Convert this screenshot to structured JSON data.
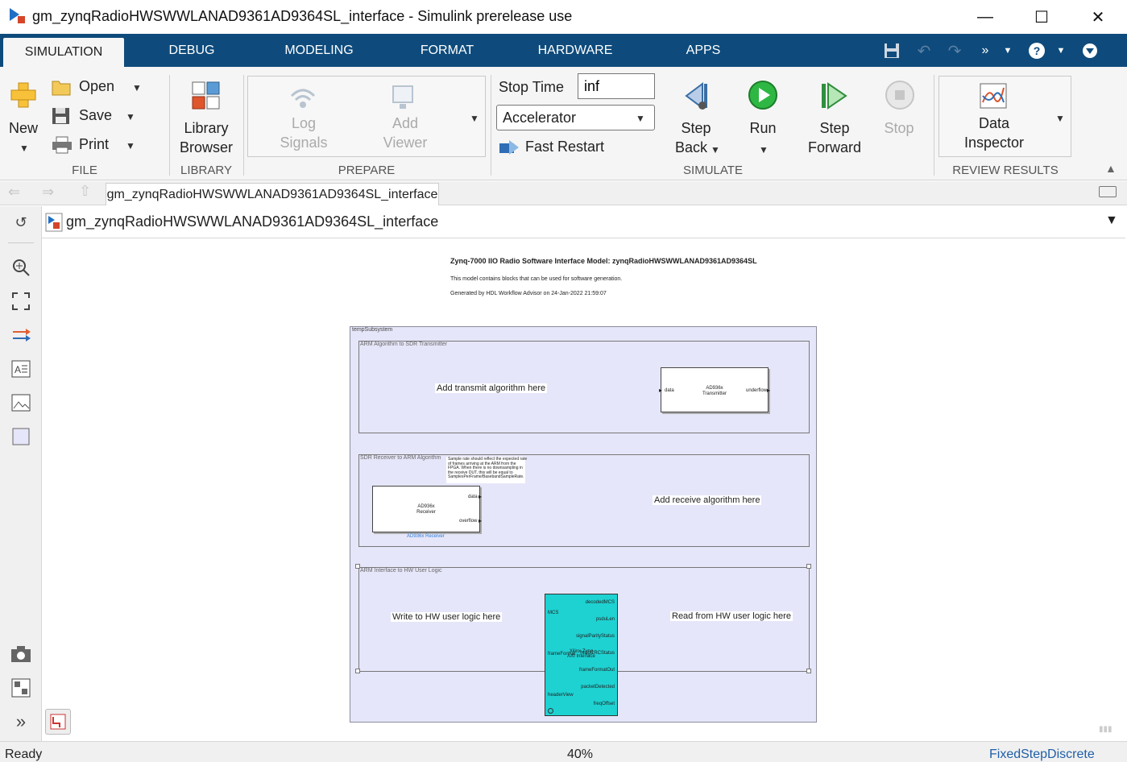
{
  "window": {
    "title": "gm_zynqRadioHWSWWLANAD9361AD9364SL_interface - Simulink prerelease use"
  },
  "ribbon_tabs": [
    "SIMULATION",
    "DEBUG",
    "MODELING",
    "FORMAT",
    "HARDWARE",
    "APPS"
  ],
  "ribbon": {
    "file": {
      "new": "New",
      "open": "Open",
      "save": "Save",
      "print": "Print",
      "label": "FILE"
    },
    "library": {
      "line1": "Library",
      "line2": "Browser",
      "label": "LIBRARY"
    },
    "prepare": {
      "log1": "Log",
      "log2": "Signals",
      "add1": "Add",
      "add2": "Viewer",
      "label": "PREPARE"
    },
    "simulate": {
      "stop_time_label": "Stop Time",
      "stop_time_value": "inf",
      "mode": "Accelerator",
      "fast_restart": "Fast Restart",
      "step_back1": "Step",
      "step_back2": "Back",
      "run": "Run",
      "step_fwd1": "Step",
      "step_fwd2": "Forward",
      "stop": "Stop",
      "label": "SIMULATE"
    },
    "review": {
      "line1": "Data",
      "line2": "Inspector",
      "label": "REVIEW RESULTS"
    }
  },
  "model_tab": "gm_zynqRadioHWSWWLANAD9361AD9364SL_interface",
  "path": "gm_zynqRadioHWSWWLANAD9361AD9364SL_interface",
  "diagram": {
    "title": "Zynq-7000 IIO Radio Software Interface Model: zynqRadioHWSWWLANAD9361AD9364SL",
    "line1": "This model contains blocks that can be used for software generation.",
    "line2": "Generated by HDL Workflow Advisor on 24-Jan-2022 21:59:07",
    "subsystem": "tempSubsystem",
    "tx_area": {
      "title": "ARM Algorithm to SDR Transmitter",
      "note": "Add transmit algorithm here",
      "block_name1": "AD936x",
      "block_name2": "Transmitter",
      "in_port": "data",
      "out_port": "underflow"
    },
    "rx_area": {
      "title": "SDR Receiver to ARM Algorithm",
      "note": "Add receive algorithm here",
      "annotation1": "Sample rate should reflect the expected rate",
      "annotation2": "of frames arriving at the ARM from the",
      "annotation3": "FPGA. When there is no downsampling in",
      "annotation4": "the receive DUT, this will be equal to",
      "annotation5": "SamplesPerFrame/BasebandSampleRate.",
      "block_name1": "AD936x",
      "block_name2": "Receiver",
      "out_port1": "data",
      "out_port2": "overflow",
      "caption": "AD936x Receiver"
    },
    "hw_area": {
      "title": "ARM Interface to HW User Logic",
      "write_note": "Write to HW user logic here",
      "read_note": "Read from HW user logic here",
      "block_name1": "Xilinx Zynq",
      "block_name2": "AXI Interface",
      "in_ports": [
        "MCS",
        "frameFormat",
        "headerView"
      ],
      "out_ports": [
        "decodedMCS",
        "psduLen",
        "signalParityStatus",
        "htsigCRCStatus",
        "frameFormatOut",
        "packetDetected",
        "freqOffset"
      ]
    }
  },
  "status": {
    "left": "Ready",
    "zoom": "40%",
    "solver": "FixedStepDiscrete"
  },
  "colors": {
    "tabbar": "#0e4b7c",
    "area": "#e6e6fa",
    "axi_block": "#1ed2d2",
    "solver_link": "#1f5fa8"
  }
}
